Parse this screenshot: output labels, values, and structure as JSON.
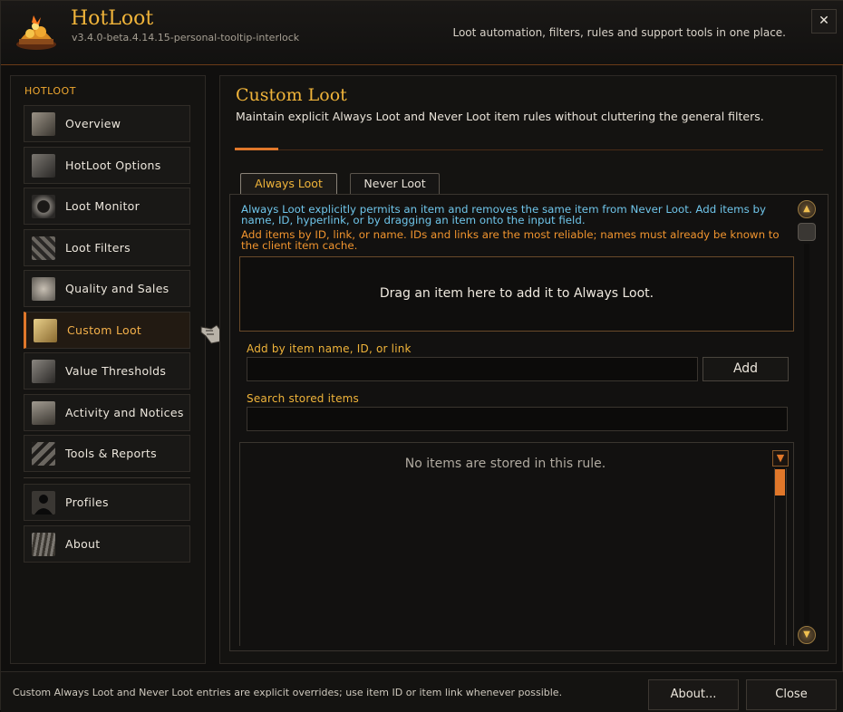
{
  "app": {
    "title": "HotLoot",
    "version": "v3.4.0-beta.4.14.15-personal-tooltip-interlock",
    "tagline": "Loot automation, filters, rules and support tools in one place.",
    "close_label": "✕"
  },
  "sidebar": {
    "heading": "HOTLOOT",
    "items": [
      {
        "label": "Overview",
        "icon": "overview-icon",
        "color": "#8c8478"
      },
      {
        "label": "HotLoot Options",
        "icon": "options-icon",
        "color": "#6e6a64"
      },
      {
        "label": "Loot Monitor",
        "icon": "monitor-icon",
        "color": "#5a5650"
      },
      {
        "label": "Loot Filters",
        "icon": "filter-icon",
        "color": "#6a6660"
      },
      {
        "label": "Quality and Sales",
        "icon": "quality-icon",
        "color": "#9a9286"
      },
      {
        "label": "Custom Loot",
        "icon": "custom-loot-icon",
        "color": "#c9a866"
      },
      {
        "label": "Value Thresholds",
        "icon": "thresholds-icon",
        "color": "#6e6a64"
      },
      {
        "label": "Activity and Notices",
        "icon": "notices-icon",
        "color": "#8c8478"
      },
      {
        "label": "Tools & Reports",
        "icon": "tools-icon",
        "color": "#5a5650"
      },
      {
        "label": "Profiles",
        "icon": "profile-icon",
        "color": "#2a2826"
      },
      {
        "label": "About",
        "icon": "about-icon",
        "color": "#6a6660"
      }
    ],
    "active_index": 5
  },
  "main": {
    "title": "Custom Loot",
    "subtitle": "Maintain explicit Always Loot and Never Loot item rules without cluttering the general filters.",
    "tabs": [
      {
        "label": "Always Loot",
        "active": true
      },
      {
        "label": "Never Loot",
        "active": false
      }
    ],
    "info_blue": "Always Loot explicitly permits an item and removes the same item from Never Loot. Add items by name, ID, hyperlink, or by dragging an item onto the input field.",
    "info_orange": "Add items by ID, link, or name. IDs and links are the most reliable; names must already be known to the client item cache.",
    "drop_zone_text": "Drag an item here to add it to Always Loot.",
    "add_label": "Add by item name, ID, or link",
    "add_value": "",
    "add_button": "Add",
    "search_label": "Search stored items",
    "search_value": "",
    "empty_message": "No items are stored in this rule."
  },
  "footer": {
    "text": "Custom Always Loot and Never Loot entries are explicit overrides; use item ID or item link whenever possible.",
    "about_button": "About...",
    "close_button": "Close"
  },
  "colors": {
    "accent": "#e0772a",
    "gold": "#f0b43a",
    "info_blue": "#6fc5ea",
    "info_orange": "#f0942e"
  }
}
